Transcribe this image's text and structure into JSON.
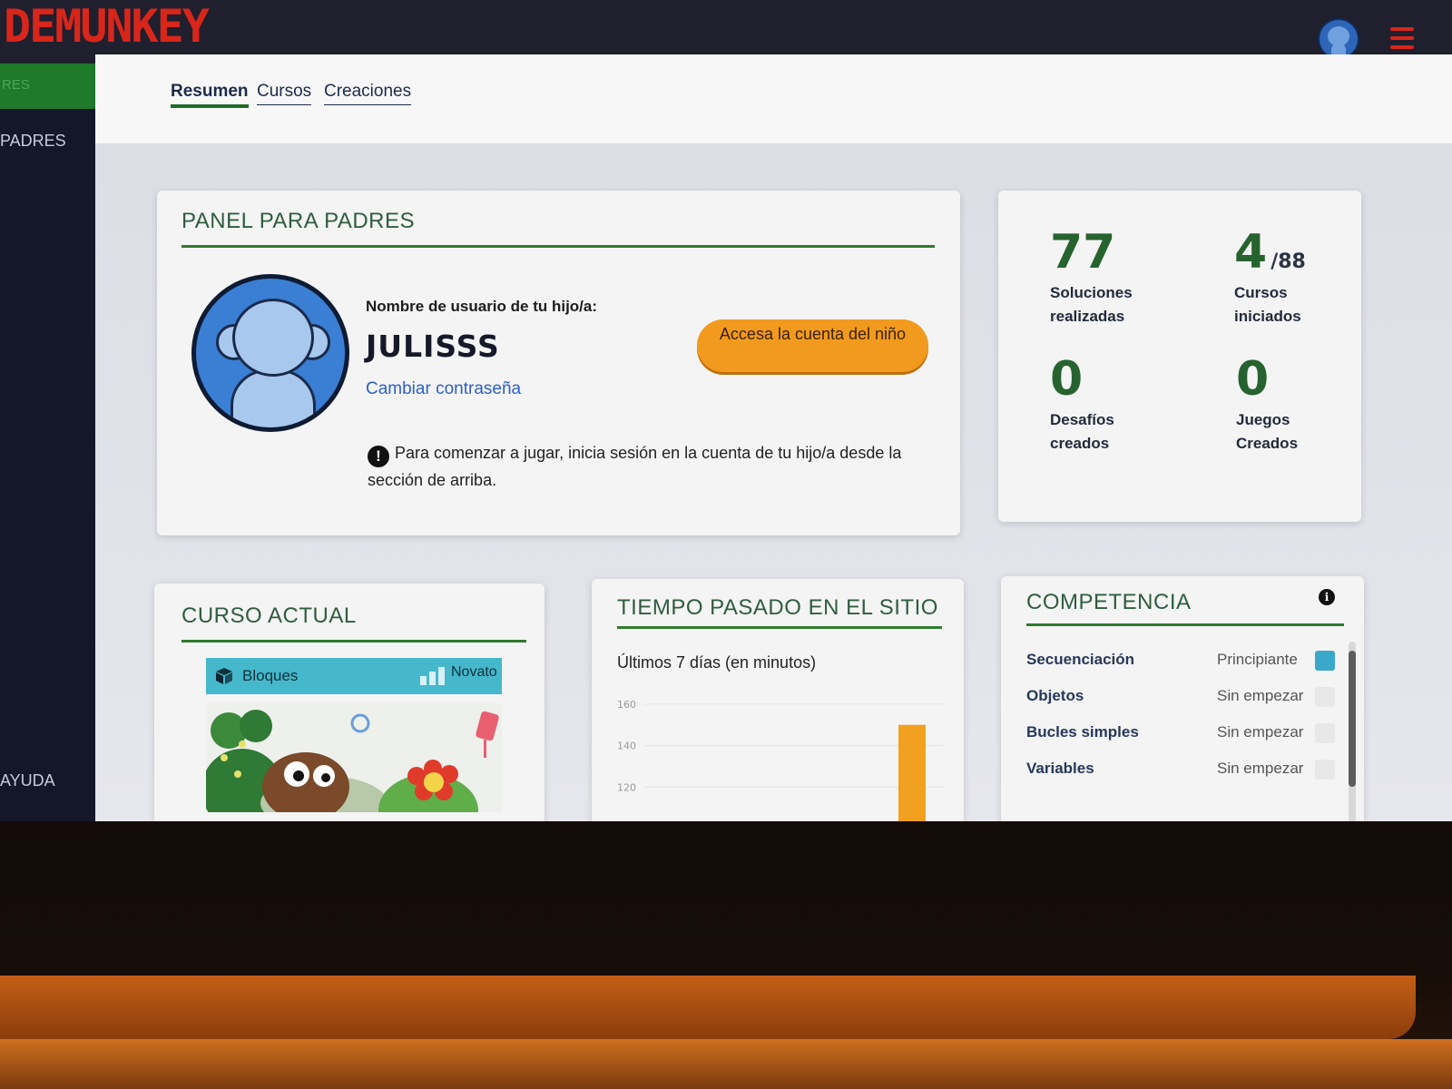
{
  "app": {
    "logo_text": "DEMUNKEY",
    "brand_color": "#d8261b",
    "accent_green": "#2f7a2f"
  },
  "sidebar": {
    "active_label": "RES",
    "items": [
      {
        "label": "PADRES"
      },
      {
        "label": "AYUDA"
      }
    ]
  },
  "tabs": [
    {
      "label": "Resumen",
      "active": true
    },
    {
      "label": "Cursos",
      "active": false
    },
    {
      "label": "Creaciones",
      "active": false
    }
  ],
  "parent_panel": {
    "title": "PANEL PARA PADRES",
    "username_label": "Nombre de usuario de tu hijo/a:",
    "username": "JULISSS",
    "change_password": "Cambiar contraseña",
    "access_button": "Accesa la cuenta del niño",
    "notice_icon": "!",
    "notice": "Para comenzar a jugar, inicia sesión en la cuenta de tu hijo/a desde la sección de arriba."
  },
  "stats": [
    {
      "value": "77",
      "suffix": "",
      "label": "Soluciones realizadas"
    },
    {
      "value": "4",
      "suffix": "/88",
      "label": "Cursos iniciados"
    },
    {
      "value": "0",
      "suffix": "",
      "label": "Desafíos creados"
    },
    {
      "value": "0",
      "suffix": "",
      "label": "Juegos Creados"
    }
  ],
  "current_course": {
    "title": "CURSO ACTUAL",
    "course_name": "Bloques",
    "level": "Novato",
    "banner_color": "#45b8cb"
  },
  "time_on_site": {
    "title": "TIEMPO PASADO EN EL SITIO",
    "subtitle": "Últimos 7 días (en minutos)",
    "chart_data": {
      "type": "bar",
      "y_ticks": [
        "160",
        "140",
        "120"
      ],
      "bar_color": "#f2a020",
      "visible_bars": [
        {
          "value": 150
        }
      ]
    }
  },
  "competencia": {
    "title": "COMPETENCIA",
    "info_icon": "i",
    "rows": [
      {
        "name": "Secuenciación",
        "status": "Principiante",
        "color": "#3aa8c8"
      },
      {
        "name": "Objetos",
        "status": "Sin empezar",
        "color": "#e8e8e8"
      },
      {
        "name": "Bucles simples",
        "status": "Sin empezar",
        "color": "#e8e8e8"
      },
      {
        "name": "Variables",
        "status": "Sin empezar",
        "color": "#e8e8e8"
      }
    ]
  }
}
